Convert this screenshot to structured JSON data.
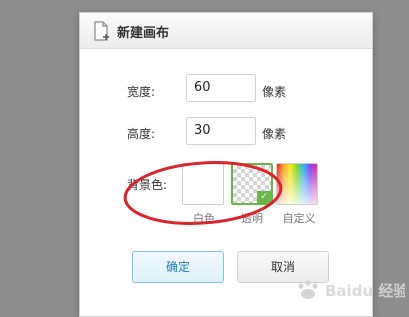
{
  "dialog": {
    "title": "新建画布",
    "width_label": "宽度:",
    "width_value": "60",
    "width_unit": "像素",
    "height_label": "高度:",
    "height_value": "30",
    "height_unit": "像素",
    "bg_label": "背景色:",
    "bg_options": [
      {
        "label": "白色",
        "color": "#ffffff"
      },
      {
        "label": "透明",
        "selected": true
      },
      {
        "label": "自定义"
      }
    ],
    "ok_label": "确定",
    "cancel_label": "取消"
  },
  "watermark": {
    "text": "Baidu 经验"
  },
  "colors": {
    "accent_green": "#6ab84a",
    "annotation_red": "#d9262c",
    "ok_border": "#7ec3e0"
  },
  "icons": [
    "document-new-icon",
    "checkmark-icon"
  ]
}
